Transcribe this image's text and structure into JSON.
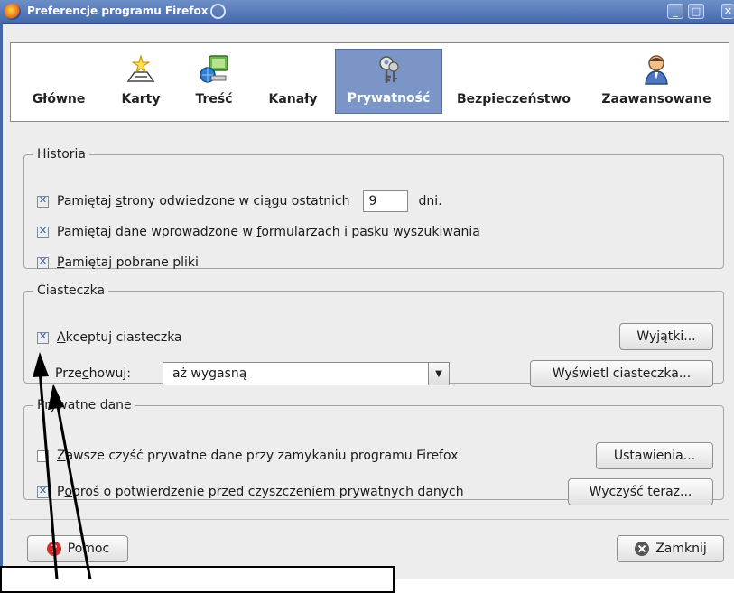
{
  "window": {
    "title": "Preferencje programu Firefox",
    "accent_color": "#4568ab"
  },
  "panes": [
    {
      "label": "Główne",
      "icon": "general-icon"
    },
    {
      "label": "Karty",
      "icon": "tabs-icon"
    },
    {
      "label": "Treść",
      "icon": "content-icon"
    },
    {
      "label": "Kanały",
      "icon": "feeds-icon"
    },
    {
      "label": "Prywatność",
      "icon": "keys-icon",
      "selected": true
    },
    {
      "label": "Bezpieczeństwo",
      "icon": "security-icon"
    },
    {
      "label": "Zaawansowane",
      "icon": "advanced-icon"
    }
  ],
  "history": {
    "legend": "Historia",
    "remember_visited_pre": "Pamiętaj ",
    "remember_visited_u": "s",
    "remember_visited_mid": "trony odwiedzone w cią",
    "remember_visited_u2": "g",
    "remember_visited_post": "u ostatnich",
    "days_value": "9",
    "days_label": "dni.",
    "remember_forms_pre": "Pamiętaj dane wprowadzone w ",
    "remember_forms_u": "f",
    "remember_forms_post": "ormularzach i pasku wyszukiwania",
    "remember_downloads_u": "P",
    "remember_downloads_post": "amiętaj pobrane pliki"
  },
  "cookies": {
    "legend": "Ciasteczka",
    "accept_u": "A",
    "accept_post": "kceptuj ciasteczka",
    "exceptions_button_pre": "Wy",
    "exceptions_button_u": "j",
    "exceptions_button_post": "ątki...",
    "keep_label_pre": "Prze",
    "keep_label_u": "c",
    "keep_label_post": "howuj:",
    "keep_value": "aż wygasną",
    "show_button": "Wyświetl ciasteczka..."
  },
  "private": {
    "legend": "Prywatne dane",
    "always_clear_u": "Z",
    "always_clear_post": "awsze czyść prywatne dane przy zamykaniu programu Firefox",
    "settings_button": "Ustawienia...",
    "ask_pre": "P",
    "ask_u": "o",
    "ask_post": "proś o potwierdzenie przed czyszczeniem prywatnych danych",
    "clear_now_button": "Wyczyść teraz..."
  },
  "footer": {
    "help_button": "Pomoc",
    "close_button": "Zamknij"
  }
}
